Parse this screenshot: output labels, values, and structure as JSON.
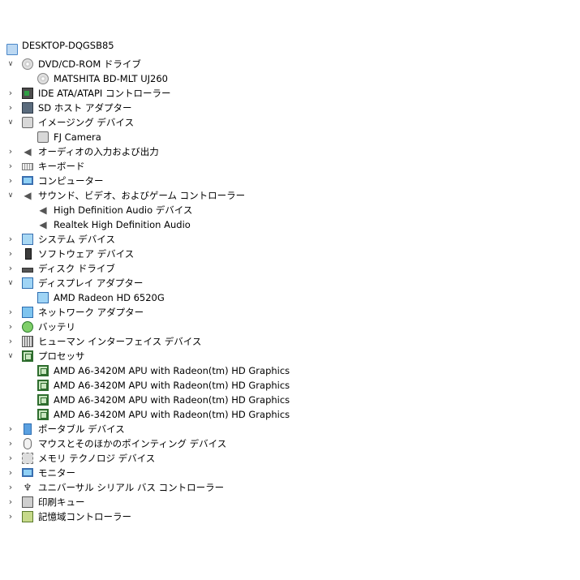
{
  "tree": [
    {
      "label": "DESKTOP-DQGSB85",
      "level": 0,
      "caret": "",
      "icon": "computer-icon",
      "root": true
    },
    {
      "label": "DVD/CD-ROM ドライブ",
      "level": 1,
      "caret": "expanded",
      "icon": "disc-drive-icon"
    },
    {
      "label": "MATSHITA BD-MLT UJ260",
      "level": 2,
      "caret": "",
      "icon": "disc-drive-icon"
    },
    {
      "label": "IDE ATA/ATAPI コントローラー",
      "level": 1,
      "caret": "collapsed",
      "icon": "ide-controller-icon"
    },
    {
      "label": "SD ホスト アダプター",
      "level": 1,
      "caret": "collapsed",
      "icon": "sd-host-icon"
    },
    {
      "label": "イメージング デバイス",
      "level": 1,
      "caret": "expanded",
      "icon": "camera-icon"
    },
    {
      "label": "FJ Camera",
      "level": 2,
      "caret": "",
      "icon": "camera-icon"
    },
    {
      "label": "オーディオの入力および出力",
      "level": 1,
      "caret": "collapsed",
      "icon": "speaker-icon"
    },
    {
      "label": "キーボード",
      "level": 1,
      "caret": "collapsed",
      "icon": "keyboard-icon"
    },
    {
      "label": "コンピューター",
      "level": 1,
      "caret": "collapsed",
      "icon": "monitor-icon"
    },
    {
      "label": "サウンド、ビデオ、およびゲーム コントローラー",
      "level": 1,
      "caret": "expanded",
      "icon": "speaker-icon"
    },
    {
      "label": "High Definition Audio デバイス",
      "level": 2,
      "caret": "",
      "icon": "speaker-icon"
    },
    {
      "label": "Realtek High Definition Audio",
      "level": 2,
      "caret": "",
      "icon": "speaker-icon"
    },
    {
      "label": "システム デバイス",
      "level": 1,
      "caret": "collapsed",
      "icon": "system-device-icon"
    },
    {
      "label": "ソフトウェア デバイス",
      "level": 1,
      "caret": "collapsed",
      "icon": "software-device-icon"
    },
    {
      "label": "ディスク ドライブ",
      "level": 1,
      "caret": "collapsed",
      "icon": "disk-drive-icon"
    },
    {
      "label": "ディスプレイ アダプター",
      "level": 1,
      "caret": "expanded",
      "icon": "display-adapter-icon"
    },
    {
      "label": "AMD Radeon HD 6520G",
      "level": 2,
      "caret": "",
      "icon": "display-adapter-icon"
    },
    {
      "label": "ネットワーク アダプター",
      "level": 1,
      "caret": "collapsed",
      "icon": "network-adapter-icon"
    },
    {
      "label": "バッテリ",
      "level": 1,
      "caret": "collapsed",
      "icon": "battery-icon"
    },
    {
      "label": "ヒューマン インターフェイス デバイス",
      "level": 1,
      "caret": "collapsed",
      "icon": "hid-icon"
    },
    {
      "label": "プロセッサ",
      "level": 1,
      "caret": "expanded",
      "icon": "processor-icon"
    },
    {
      "label": "AMD A6-3420M APU with Radeon(tm) HD Graphics",
      "level": 2,
      "caret": "",
      "icon": "processor-icon"
    },
    {
      "label": "AMD A6-3420M APU with Radeon(tm) HD Graphics",
      "level": 2,
      "caret": "",
      "icon": "processor-icon"
    },
    {
      "label": "AMD A6-3420M APU with Radeon(tm) HD Graphics",
      "level": 2,
      "caret": "",
      "icon": "processor-icon"
    },
    {
      "label": "AMD A6-3420M APU with Radeon(tm) HD Graphics",
      "level": 2,
      "caret": "",
      "icon": "processor-icon"
    },
    {
      "label": "ポータブル デバイス",
      "level": 1,
      "caret": "collapsed",
      "icon": "portable-device-icon"
    },
    {
      "label": "マウスとそのほかのポインティング デバイス",
      "level": 1,
      "caret": "collapsed",
      "icon": "mouse-icon"
    },
    {
      "label": "メモリ テクノロジ デバイス",
      "level": 1,
      "caret": "collapsed",
      "icon": "memory-device-icon"
    },
    {
      "label": "モニター",
      "level": 1,
      "caret": "collapsed",
      "icon": "monitor-icon"
    },
    {
      "label": "ユニバーサル シリアル バス コントローラー",
      "level": 1,
      "caret": "collapsed",
      "icon": "usb-icon"
    },
    {
      "label": "印刷キュー",
      "level": 1,
      "caret": "collapsed",
      "icon": "printer-icon"
    },
    {
      "label": "記憶域コントローラー",
      "level": 1,
      "caret": "collapsed",
      "icon": "storage-controller-icon"
    }
  ],
  "carets": {
    "collapsed": "›",
    "expanded": "∨"
  }
}
